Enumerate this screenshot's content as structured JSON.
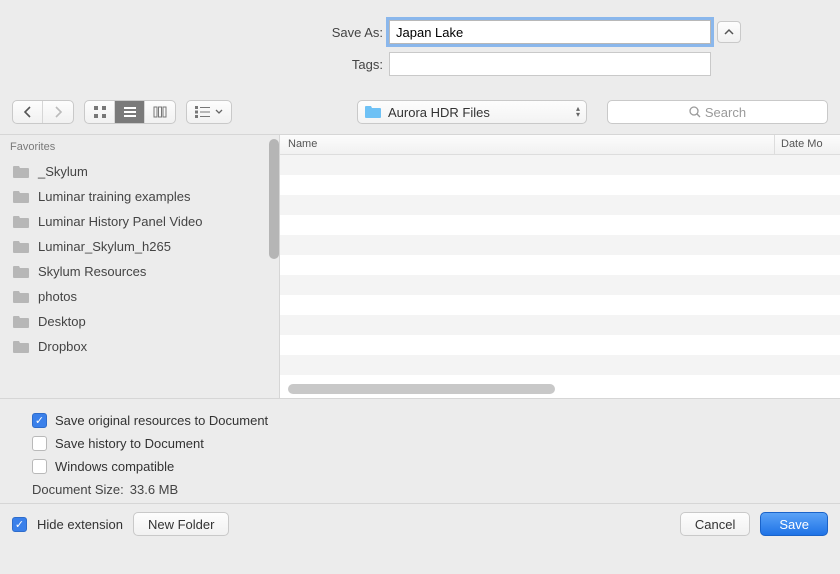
{
  "form": {
    "save_as_label": "Save As:",
    "save_as_value": "Japan Lake",
    "tags_label": "Tags:",
    "tags_value": ""
  },
  "toolbar": {
    "path_label": "Aurora HDR Files",
    "search_placeholder": "Search"
  },
  "sidebar": {
    "section": "Favorites",
    "items": [
      {
        "label": "_Skylum"
      },
      {
        "label": "Luminar training examples"
      },
      {
        "label": "Luminar History Panel Video"
      },
      {
        "label": "Luminar_Skylum_h265"
      },
      {
        "label": "Skylum Resources"
      },
      {
        "label": "photos"
      },
      {
        "label": "Desktop"
      },
      {
        "label": "Dropbox"
      }
    ]
  },
  "columns": {
    "name": "Name",
    "date": "Date Mo"
  },
  "options": {
    "save_resources_label": "Save original resources to Document",
    "save_history_label": "Save history to Document",
    "windows_compat_label": "Windows compatible",
    "doc_size_label": "Document Size:",
    "doc_size_value": "33.6 MB",
    "save_resources_checked": true,
    "save_history_checked": false,
    "windows_compat_checked": false
  },
  "footer": {
    "hide_ext_label": "Hide extension",
    "hide_ext_checked": true,
    "new_folder_label": "New Folder",
    "cancel_label": "Cancel",
    "save_label": "Save"
  }
}
